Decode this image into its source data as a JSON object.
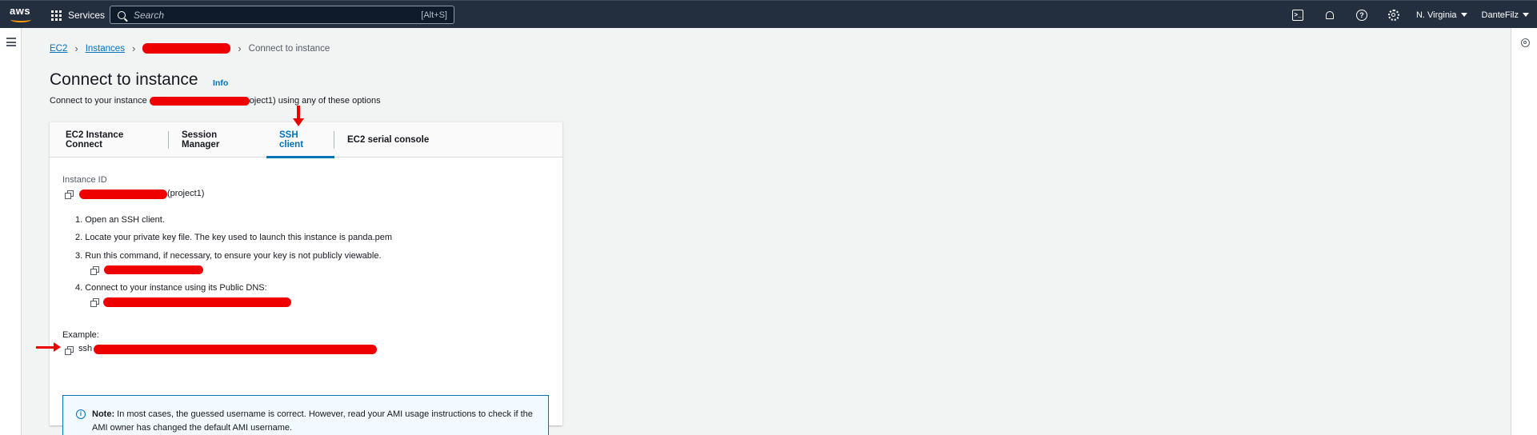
{
  "topnav": {
    "logo": "aws",
    "services_label": "Services",
    "search_placeholder": "Search",
    "search_shortcut": "[Alt+S]",
    "region": "N. Virginia",
    "account": "DanteFilz",
    "icons": [
      "cloudshell-icon",
      "bell-icon",
      "help-icon",
      "gear-icon"
    ]
  },
  "breadcrumb": {
    "items": [
      "EC2",
      "Instances"
    ],
    "current": "Connect to instance"
  },
  "page": {
    "title": "Connect to instance",
    "info_link": "Info",
    "subtitle_prefix": "Connect to your instance",
    "subtitle_suffix": "oject1) using any of these options"
  },
  "tabs": [
    {
      "label": "EC2 Instance Connect",
      "active": false
    },
    {
      "label": "Session Manager",
      "active": false
    },
    {
      "label": "SSH client",
      "active": true
    },
    {
      "label": "EC2 serial console",
      "active": false
    }
  ],
  "ssh": {
    "instance_id_label": "Instance ID",
    "instance_suffix": "(project1)",
    "steps": [
      "1. Open an SSH client.",
      "2. Locate your private key file. The key used to launch this instance is panda.pem",
      "3. Run this command, if necessary, to ensure your key is not publicly viewable.",
      "4. Connect to your instance using its Public DNS:"
    ],
    "example_label": "Example:",
    "example_prefix": "ssh"
  },
  "note": {
    "bold": "Note:",
    "text": " In most cases, the guessed username is correct. However, read your AMI usage instructions to check if the AMI owner has changed the default AMI username."
  },
  "colors": {
    "nav_bg": "#232f3e",
    "accent": "#0073bb",
    "redaction": "#ee0000",
    "aws_orange": "#ff9900"
  }
}
